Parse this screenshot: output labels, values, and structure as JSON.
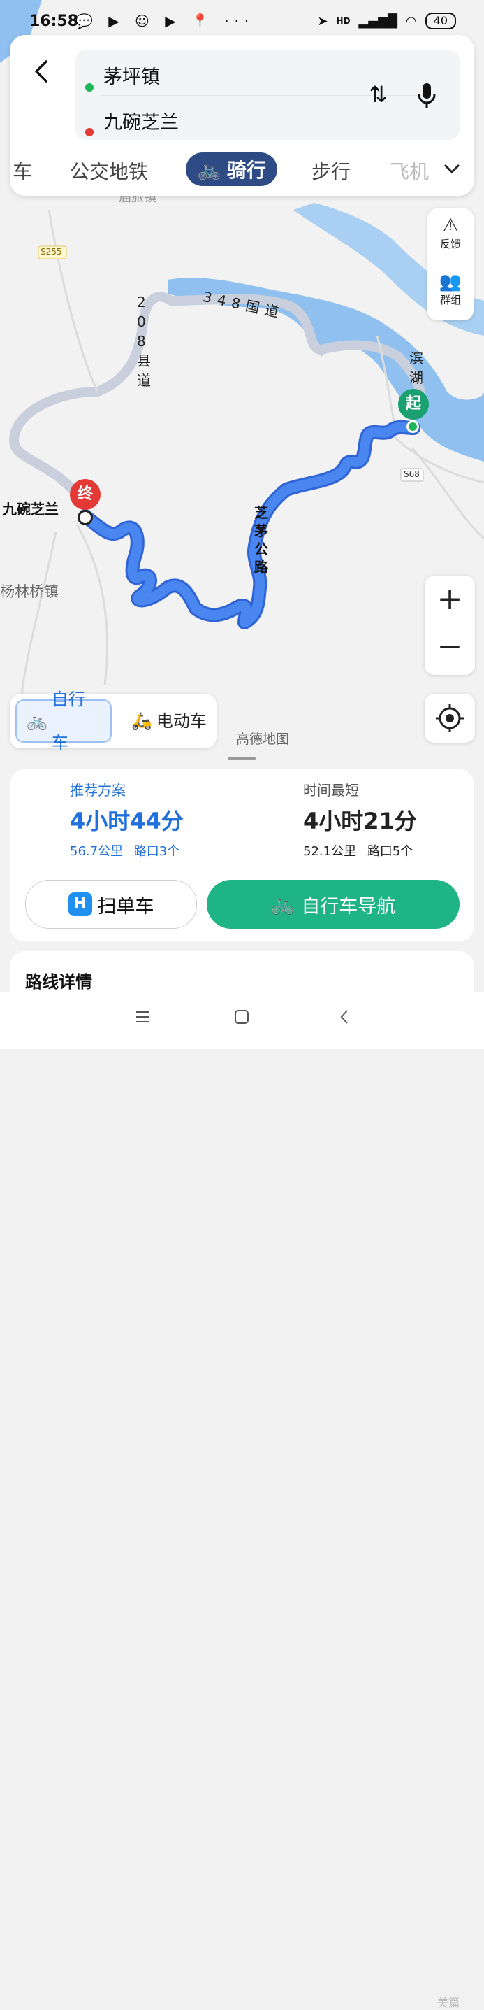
{
  "status_bar": {
    "time": "16:58",
    "app_icons": "💬 ▶ ☺ ▶ 📍 ···",
    "network": "HD",
    "battery": "40"
  },
  "search": {
    "origin": "茅坪镇",
    "destination": "九碗芝兰"
  },
  "tabs": [
    {
      "label": "车"
    },
    {
      "label": "公交地铁"
    },
    {
      "label": "骑行",
      "active": true
    },
    {
      "label": "步行"
    },
    {
      "label": "飞机"
    }
  ],
  "map": {
    "labels": {
      "s255": "S255",
      "s68": "S68",
      "road_348": "348国道",
      "road_208": "208县道",
      "road_zhimao": "芝茅公路",
      "road_binhu": "滨湖",
      "town_yanglin": "杨林桥镇",
      "dest_label": "九碗芝兰",
      "top_partial": "庙旅镇"
    },
    "markers": {
      "start": "起",
      "end": "终"
    },
    "watermark": "高德地图"
  },
  "side_buttons": {
    "feedback": "反馈",
    "group": "群组"
  },
  "vehicle_toggle": {
    "bike": "自行车",
    "ebike": "电动车"
  },
  "plans": [
    {
      "label": "推荐方案",
      "duration": "4小时44分",
      "distance": "56.7公里",
      "junctions": "路口3个"
    },
    {
      "label": "时间最短",
      "duration": "4小时21分",
      "distance": "52.1公里",
      "junctions": "路口5个"
    }
  ],
  "buttons": {
    "scan_bike": "扫单车",
    "bike_nav": "自行车导航"
  },
  "details_title": "路线详情",
  "corner_watermark": "美篇",
  "colors": {
    "route": "#3b7be8",
    "water": "#8fc0ef",
    "accent_blue": "#1f6fdc",
    "green": "#1fb483",
    "tab_active": "#2f4b85"
  }
}
